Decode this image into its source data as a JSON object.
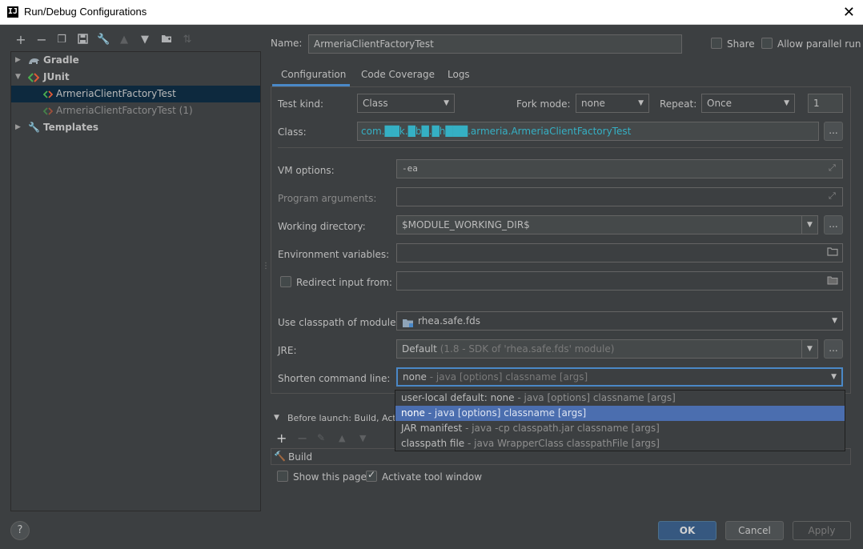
{
  "window": {
    "title": "Run/Debug Configurations",
    "icon": "intellij-logo-icon",
    "close_icon": "close-icon"
  },
  "toolbar": {
    "icons": [
      "add-icon",
      "remove-icon",
      "copy-icon",
      "save-icon",
      "wrench-icon",
      "move-up-icon",
      "move-down-icon",
      "new-folder-icon",
      "sort-icon"
    ]
  },
  "tree": {
    "items": [
      {
        "label": "Gradle",
        "icon": "gradle-elephant-icon",
        "level": 0,
        "expanded": false
      },
      {
        "label": "JUnit",
        "icon": "junit-icon",
        "level": 0,
        "expanded": true
      },
      {
        "label": "ArmeriaClientFactoryTest",
        "icon": "junit-test-icon",
        "level": 1,
        "selected": true
      },
      {
        "label": "ArmeriaClientFactoryTest (1)",
        "icon": "junit-test-icon",
        "level": 1,
        "selected": false
      },
      {
        "label": "Templates",
        "icon": "wrench-icon",
        "level": 0,
        "expanded": false
      }
    ]
  },
  "name": {
    "label": "Name:",
    "value": "ArmeriaClientFactoryTest"
  },
  "share": {
    "label": "Share",
    "checked": false
  },
  "allow_parallel": {
    "label": "Allow parallel run",
    "checked": false
  },
  "tabs": [
    {
      "label": "Configuration",
      "active": true
    },
    {
      "label": "Code Coverage",
      "active": false
    },
    {
      "label": "Logs",
      "active": false
    }
  ],
  "test_kind": {
    "label": "Test kind:",
    "value": "Class"
  },
  "fork_mode": {
    "label": "Fork mode:",
    "value": "none"
  },
  "repeat": {
    "label": "Repeat:",
    "value": "Once",
    "count": "1"
  },
  "class_field": {
    "label": "Class:",
    "value": "com.██k.█b█.█h███.armeria.ArmeriaClientFactoryTest",
    "button": "..."
  },
  "vm_options": {
    "label": "VM options:",
    "value": "-ea"
  },
  "program_arguments": {
    "label": "Program arguments:",
    "value": ""
  },
  "working_directory": {
    "label": "Working directory:",
    "value": "$MODULE_WORKING_DIR$",
    "button": "..."
  },
  "environment_variables": {
    "label": "Environment variables:",
    "value": ""
  },
  "redirect_input": {
    "label": "Redirect input from:",
    "checked": false,
    "value": ""
  },
  "classpath_module": {
    "label": "Use classpath of module:",
    "value": "rhea.safe.fds"
  },
  "jre": {
    "label": "JRE:",
    "value": "Default",
    "hint": "(1.8 - SDK of 'rhea.safe.fds' module)",
    "button": "..."
  },
  "shorten_command_line": {
    "label": "Shorten command line:",
    "value": "none",
    "value_hint": "- java [options] classname [args]",
    "options": [
      {
        "name": "user-local default: none",
        "desc": "- java [options] classname [args]",
        "selected": false
      },
      {
        "name": "none",
        "desc": "- java [options] classname [args]",
        "selected": true
      },
      {
        "name": "JAR manifest",
        "desc": "- java -cp classpath.jar classname [args]",
        "selected": false
      },
      {
        "name": "classpath file",
        "desc": "- java WrapperClass classpathFile [args]",
        "selected": false
      }
    ]
  },
  "before_launch": {
    "label": "Before launch: Build, Activa",
    "items": [
      {
        "label": "Build",
        "icon": "hammer-icon"
      }
    ]
  },
  "show_this_page": {
    "label": "Show this page",
    "checked": false
  },
  "activate_tool_window": {
    "label": "Activate tool window",
    "checked": true
  },
  "buttons": {
    "ok": "OK",
    "cancel": "Cancel",
    "apply": "Apply",
    "help": "?"
  },
  "colors": {
    "accent": "#4a88c7",
    "selection": "#4b6eaf",
    "tree_selection": "#0d293e",
    "link_text": "#35b0c4",
    "ok_button": "#365880"
  }
}
